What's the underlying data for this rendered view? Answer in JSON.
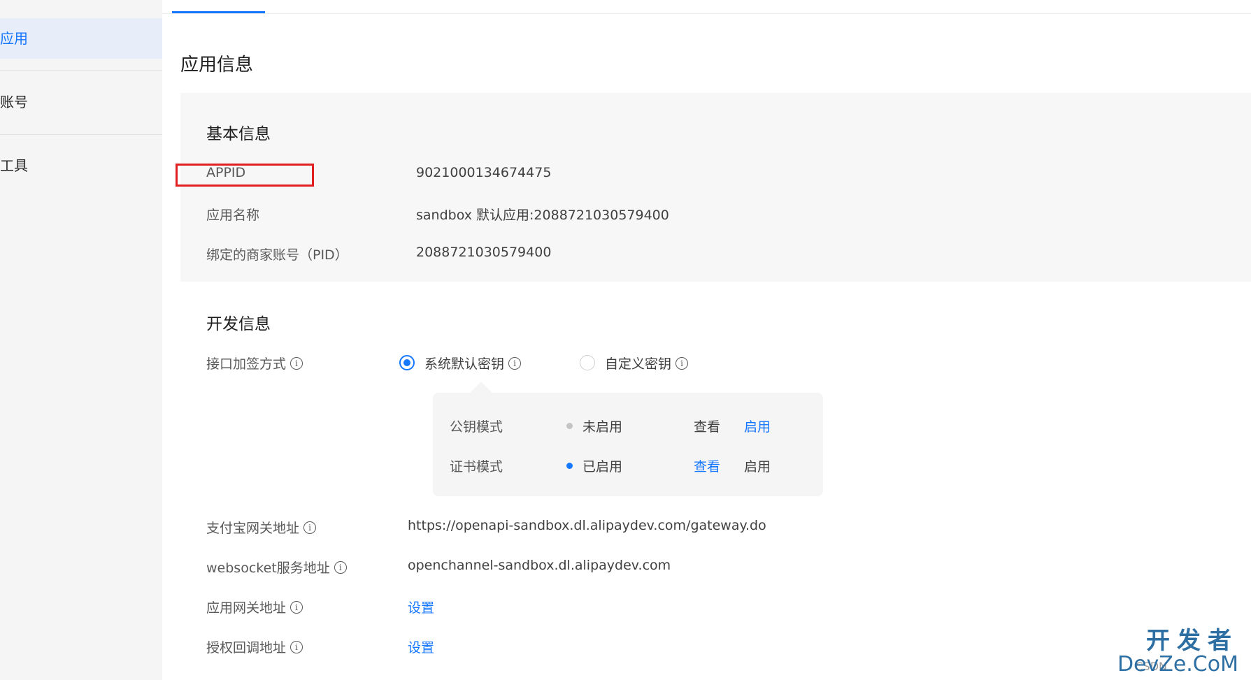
{
  "sidebar": {
    "items": [
      {
        "label": "应用",
        "active": true
      },
      {
        "label": "账号",
        "active": false
      },
      {
        "label": "工具",
        "active": false
      }
    ]
  },
  "page": {
    "title": "应用信息"
  },
  "basic_info": {
    "title": "基本信息",
    "rows": [
      {
        "label": "APPID",
        "value": "9021000134674475"
      },
      {
        "label": "应用名称",
        "value": "sandbox 默认应用:2088721030579400"
      },
      {
        "label": "绑定的商家账号（PID）",
        "value": "2088721030579400"
      }
    ]
  },
  "dev_info": {
    "title": "开发信息",
    "sign_method": {
      "label": "接口加签方式",
      "options": [
        {
          "label": "系统默认密钥",
          "checked": true
        },
        {
          "label": "自定义密钥",
          "checked": false
        }
      ]
    },
    "modes": [
      {
        "name": "公钥模式",
        "status": "未启用",
        "status_color": "#c4c4c4",
        "view": "查看",
        "enable": "启用"
      },
      {
        "name": "证书模式",
        "status": "已启用",
        "status_color": "#1677ff",
        "view": "查看",
        "enable": "启用"
      }
    ],
    "gateway": {
      "label": "支付宝网关地址",
      "value": "https://openapi-sandbox.dl.alipaydev.com/gateway.do"
    },
    "websocket": {
      "label": "websocket服务地址",
      "value": "openchannel-sandbox.dl.alipaydev.com"
    },
    "app_gateway": {
      "label": "应用网关地址",
      "link": "设置"
    },
    "callback": {
      "label": "授权回调地址",
      "link": "设置"
    }
  },
  "watermark": {
    "cn": "开发者",
    "en": "DevZe.CoM",
    "csdn": "CSDN"
  },
  "colors": {
    "accent": "#1677ff",
    "highlight": "#e02020"
  }
}
